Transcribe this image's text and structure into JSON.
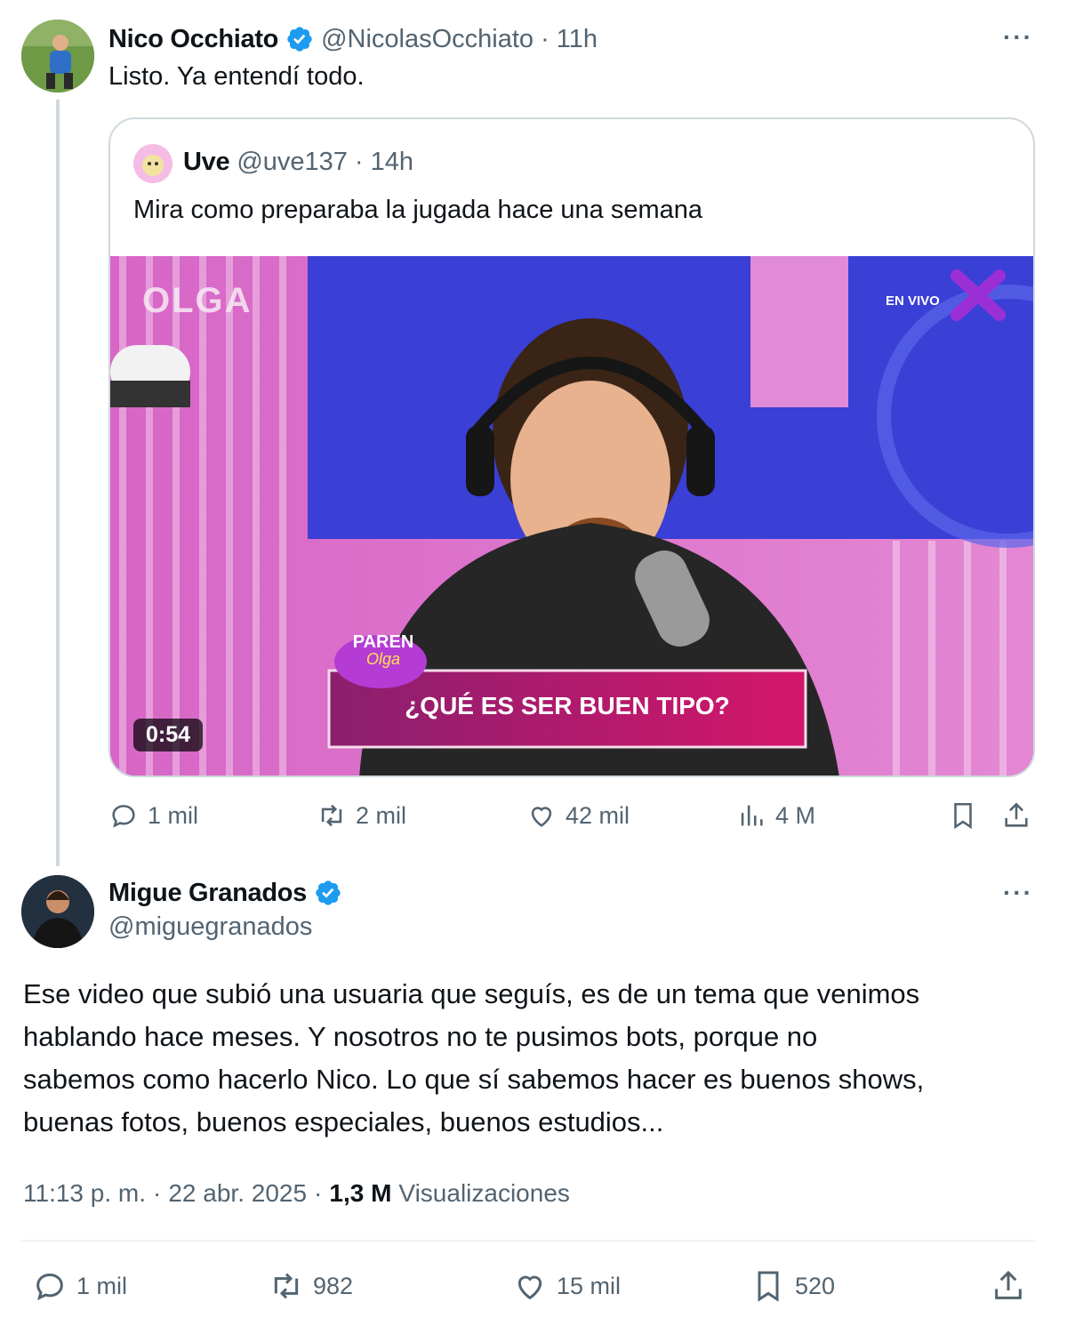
{
  "tweet1": {
    "author_name": "Nico Occhiato",
    "handle": "@NicolasOcchiato",
    "time": "11h",
    "text": "Listo. Ya entendí todo.",
    "more": "···"
  },
  "quote": {
    "author_name": "Uve",
    "handle": "@uve137",
    "time": "14h",
    "text": "Mira como preparaba la jugada hace una semana",
    "video": {
      "duration": "0:54",
      "banner_text": "¿QUÉ ES SER BUEN TIPO?",
      "studio_sign": "OLGA",
      "live_label": "EN VIVO",
      "show_logo_top": "PAREN",
      "show_logo_bottom": "Olga"
    }
  },
  "tweet1_actions": {
    "replies": "1 mil",
    "retweets": "2 mil",
    "likes": "42 mil",
    "views": "4 M"
  },
  "tweet2": {
    "author_name": "Migue Granados",
    "handle": "@miguegranados",
    "more": "···",
    "text_lines": [
      "Ese video que subió una usuaria que seguís, es de un tema que venimos",
      "hablando hace meses. Y nosotros no te pusimos bots, porque no",
      "sabemos como hacerlo Nico. Lo que sí sabemos hacer es buenos shows,",
      "buenas fotos, buenos especiales, buenos estudios..."
    ],
    "time": "11:13 p. m.",
    "date": "22 abr. 2025",
    "views_count": "1,3 M",
    "views_label": "Visualizaciones"
  },
  "tweet2_actions": {
    "replies": "1 mil",
    "retweets": "982",
    "likes": "15 mil",
    "bookmarks": "520"
  },
  "colors": {
    "verified_blue": "#1d9bf0",
    "muted": "#536471",
    "border": "#cfd9de"
  }
}
